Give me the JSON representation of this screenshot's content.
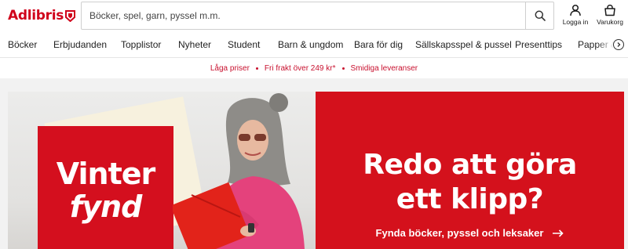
{
  "header": {
    "logo_text": "Adlibris",
    "search_placeholder": "Böcker, spel, garn, pyssel m.m.",
    "login_label": "Logga in",
    "cart_label": "Varukorg"
  },
  "categories": [
    "Böcker",
    "Erbjudanden",
    "Topplistor",
    "Nyheter",
    "Student",
    "Barn & ungdom",
    "Bara för dig",
    "Sällskapsspel & pussel",
    "Presenttips",
    "Papper &"
  ],
  "usps": [
    "Låga priser",
    "Fri frakt över 249 kr*",
    "Smidiga leveranser"
  ],
  "hero": {
    "sticker_line1": "Vinter",
    "sticker_line2": "fynd",
    "title": "Redo att göra\nett klipp?",
    "cta": "Fynda böcker, pyssel och leksaker"
  },
  "colors": {
    "brand": "#d0021b",
    "usp": "#c8102e",
    "hero_red": "#d4111c"
  }
}
